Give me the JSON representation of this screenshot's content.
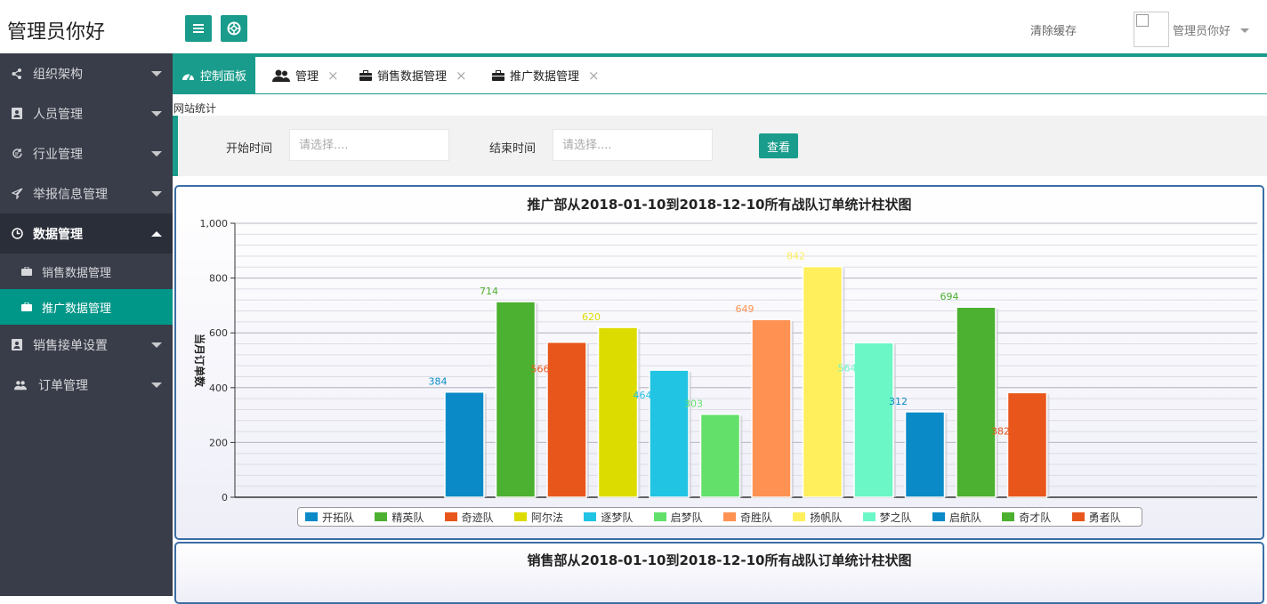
{
  "header": {
    "brand": "管理员你好",
    "clear_cache": "清除缓存",
    "user_name": "管理员你好"
  },
  "sidebar": {
    "items": [
      {
        "label": "组织架构",
        "icon": "share-icon"
      },
      {
        "label": "人员管理",
        "icon": "contact-book-icon"
      },
      {
        "label": "行业管理",
        "icon": "refresh-euro-icon"
      },
      {
        "label": "举报信息管理",
        "icon": "paper-plane-icon"
      },
      {
        "label": "数据管理",
        "icon": "clock-icon"
      },
      {
        "label": "销售接单设置",
        "icon": "contact-book-icon"
      },
      {
        "label": "订单管理",
        "icon": "users-icon"
      }
    ],
    "sub_items": [
      {
        "label": "销售数据管理",
        "icon": "briefcase-icon"
      },
      {
        "label": "推广数据管理",
        "icon": "briefcase-icon"
      }
    ]
  },
  "tabs": [
    {
      "label": "控制面板",
      "icon": "dashboard-icon"
    },
    {
      "label": "管理",
      "icon": "users-icon"
    },
    {
      "label": "销售数据管理",
      "icon": "briefcase-icon"
    },
    {
      "label": "推广数据管理",
      "icon": "briefcase-icon"
    }
  ],
  "tab_close": "×",
  "section_label": "网站统计",
  "filter": {
    "start_label": "开始时间",
    "start_placeholder": "请选择....",
    "end_label": "结束时间",
    "end_placeholder": "请选择....",
    "query_button": "查看"
  },
  "colors": {
    "accent": "#1a9c8c",
    "sidebar_bg": "#393d49",
    "panel_border": "#3a6ea5"
  },
  "chart_data": {
    "type": "bar",
    "title": "推广部从2018-01-10到2018-12-10所有战队订单统计柱状图",
    "ylabel": "当月订单数",
    "xlabel": "",
    "ylim": [
      0,
      1000
    ],
    "yticks": [
      "0",
      "200",
      "400",
      "600",
      "800",
      "1,000"
    ],
    "grid": true,
    "legend_position": "bottom",
    "categories": [
      "开拓队",
      "精英队",
      "奇迹队",
      "阿尔法",
      "逐梦队",
      "启梦队",
      "奇胜队",
      "扬帆队",
      "梦之队",
      "启航队",
      "奇才队",
      "勇者队"
    ],
    "values": [
      384,
      714,
      566,
      620,
      464,
      303,
      649,
      842,
      564,
      312,
      694,
      382
    ],
    "colors": [
      "#0a8bc7",
      "#4cb030",
      "#e8561c",
      "#dcdc00",
      "#22c4e4",
      "#62e06a",
      "#ff9252",
      "#ffef5c",
      "#6bf7c6",
      "#0a8bc7",
      "#4cb030",
      "#e8561c"
    ]
  },
  "second_chart": {
    "title": "销售部从2018-01-10到2018-12-10所有战队订单统计柱状图"
  }
}
